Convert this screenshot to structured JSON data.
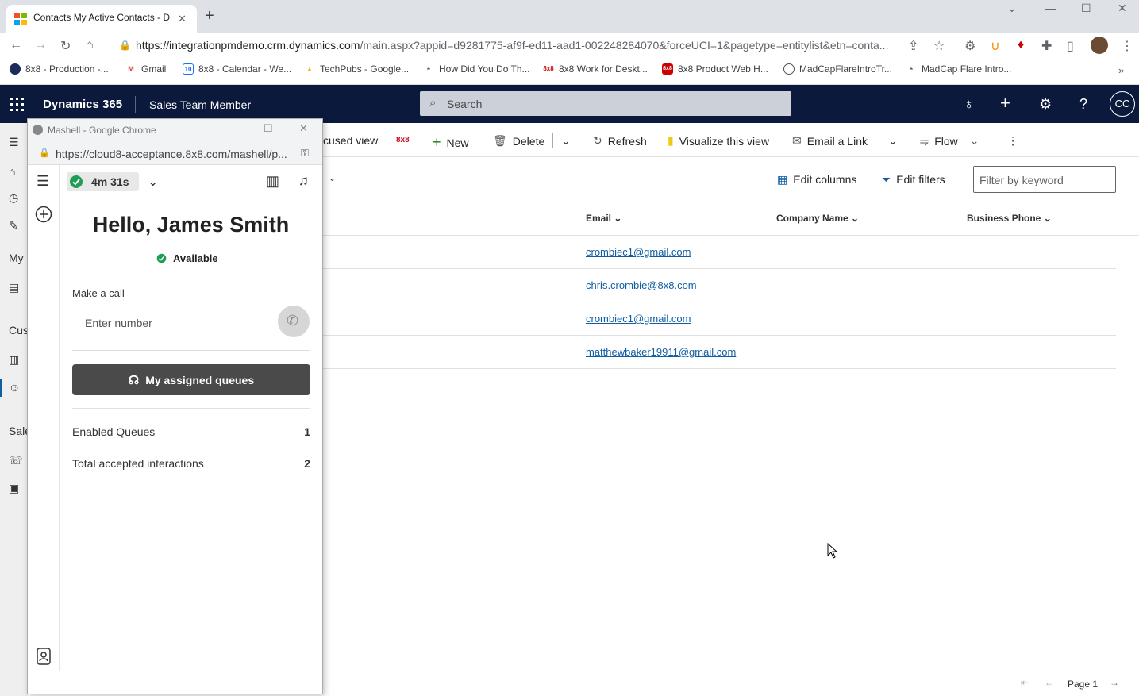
{
  "browser": {
    "tab_title": "Contacts My Active Contacts - D",
    "url_host": "https://integrationpmdemo.crm.dynamics.com",
    "url_rest": "/main.aspx?appid=d9281775-af9f-ed11-aad1-002248284070&forceUCI=1&pagetype=entitylist&etn=conta...",
    "bookmarks": [
      "8x8 - Production -...",
      "Gmail",
      "8x8 - Calendar - We...",
      "TechPubs - Google...",
      "How Did You Do Th...",
      "8x8 Work for Deskt...",
      "8x8 Product Web H...",
      "MadCapFlareIntroTr...",
      "MadCap Flare Intro..."
    ]
  },
  "header": {
    "brand": "Dynamics 365",
    "area": "Sales Team Member",
    "search_placeholder": "Search",
    "avatar": "CC"
  },
  "leftnav": {
    "my": "My",
    "customers": "Cus",
    "sales": "Sale"
  },
  "commands": {
    "focused_view": "cused view",
    "brand_8x8": "8x8",
    "new": "New",
    "delete": "Delete",
    "refresh": "Refresh",
    "visualize": "Visualize this view",
    "email_link": "Email a Link",
    "flow": "Flow"
  },
  "grid": {
    "edit_columns": "Edit columns",
    "edit_filters": "Edit filters",
    "filter_placeholder": "Filter by keyword",
    "columns": [
      "Email",
      "Company Name",
      "Business Phone"
    ],
    "rows": [
      {
        "email": "crombiec1@gmail.com"
      },
      {
        "email": "chris.crombie@8x8.com"
      },
      {
        "email": "crombiec1@gmail.com"
      },
      {
        "email": "matthewbaker19911@gmail.com"
      }
    ],
    "page_label": "Page 1"
  },
  "popup": {
    "window_title": "Mashell - Google Chrome",
    "url": "https://cloud8-acceptance.8x8.com/mashell/p...",
    "timer": "4m 31s",
    "greeting": "Hello, James Smith",
    "status": "Available",
    "make_call_label": "Make a call",
    "number_placeholder": "Enter number",
    "queues_button": "My assigned queues",
    "stats": [
      {
        "label": "Enabled Queues",
        "value": "1"
      },
      {
        "label": "Total accepted interactions",
        "value": "2"
      }
    ]
  },
  "colors": {
    "header_bg": "#0b1a3c",
    "link": "#115ea3",
    "available": "#1f9d55",
    "queue_button": "#4a4a4a"
  }
}
